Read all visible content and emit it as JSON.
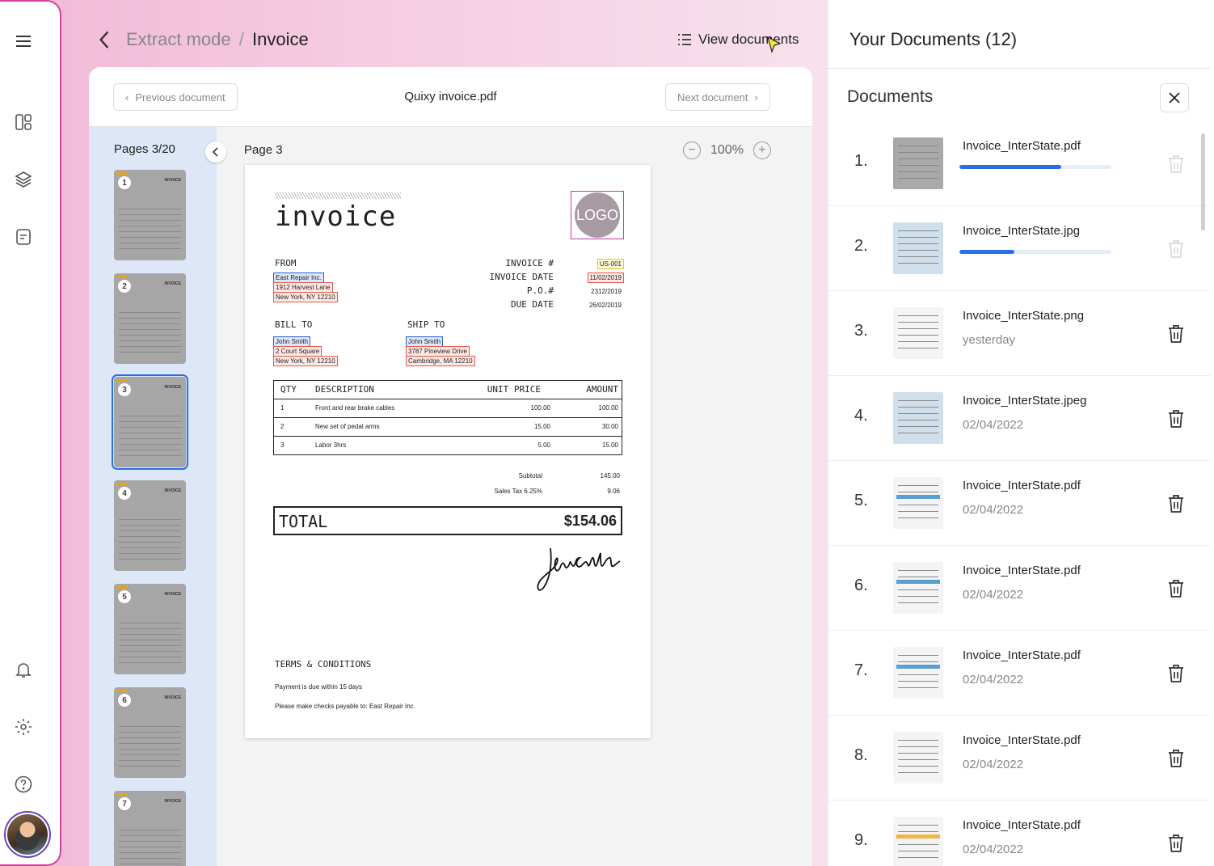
{
  "breadcrumb": {
    "mode": "Extract mode",
    "separator": "/",
    "current": "Invoice"
  },
  "view_documents_label": "View documents",
  "doc_nav": {
    "prev_label": "Previous document",
    "next_label": "Next document",
    "filename": "Quixy invoice.pdf"
  },
  "pages_label": "Pages 3/20",
  "page_label": "Page 3",
  "zoom": {
    "value": "100%",
    "minus": "−",
    "plus": "+"
  },
  "thumbnails": [
    {
      "num": "1",
      "title": "INVOICE"
    },
    {
      "num": "2",
      "title": "INVOICE"
    },
    {
      "num": "3",
      "title": "INVOICE",
      "active": true
    },
    {
      "num": "4",
      "title": "INVOICE"
    },
    {
      "num": "5",
      "title": "INVOICE"
    },
    {
      "num": "6",
      "title": "INVOICE"
    },
    {
      "num": "7",
      "title": "INVOICE"
    }
  ],
  "invoice": {
    "title": "invoice",
    "logo": "LOGO",
    "from_label": "FROM",
    "from_lines": [
      "East Repair Inc.",
      "1912 Harvest Lane",
      "New York, NY 12210"
    ],
    "meta_labels": [
      "INVOICE #",
      "INVOICE DATE",
      "P.O.#",
      "DUE DATE"
    ],
    "meta_values": [
      "US-001",
      "11/02/2019",
      "2312/2019",
      "26/02/2019"
    ],
    "bill_to_label": "BILL TO",
    "bill_to_lines": [
      "John Smith",
      "2 Court Square",
      "New York, NY 12210"
    ],
    "ship_to_label": "SHIP TO",
    "ship_to_lines": [
      "John Smith",
      "3787 Pineview Drive",
      "Cambridge, MA 12210"
    ],
    "table_headers": [
      "QTY",
      "DESCRIPTION",
      "UNIT PRICE",
      "AMOUNT"
    ],
    "table_rows": [
      [
        "1",
        "Front and rear brake cables",
        "100.00",
        "100.00"
      ],
      [
        "2",
        "New set of pedal arms",
        "15.00",
        "30.00"
      ],
      [
        "3",
        "Labor 3hrs",
        "5.00",
        "15.00"
      ]
    ],
    "subtotal_label": "Subtotal",
    "subtotal_value": "145.00",
    "tax_label": "Sales Tax 6.25%",
    "tax_value": "9.06",
    "total_label": "TOTAL",
    "total_value": "$154.06",
    "signature": "John Smith",
    "terms_label": "TERMS & CONDITIONS",
    "terms_lines": [
      "Payment is due within 15 days",
      "Please make checks payable to: East Repair Inc."
    ]
  },
  "documents_panel": {
    "title": "Your Documents (12)",
    "subtitle": "Documents",
    "items": [
      {
        "num": "1.",
        "name": "Invoice_InterState.pdf",
        "meta": "",
        "progress": 0.67,
        "thumb": "gray"
      },
      {
        "num": "2.",
        "name": "Invoice_InterState.jpg",
        "meta": "",
        "progress": 0.36,
        "thumb": "blue"
      },
      {
        "num": "3.",
        "name": "Invoice_InterState.png",
        "meta": "yesterday",
        "thumb": "text"
      },
      {
        "num": "4.",
        "name": "Invoice_InterState.jpeg",
        "meta": "02/04/2022",
        "thumb": "blue"
      },
      {
        "num": "5.",
        "name": "Invoice_InterState.pdf",
        "meta": "02/04/2022",
        "thumb": "light"
      },
      {
        "num": "6.",
        "name": "Invoice_InterState.pdf",
        "meta": "02/04/2022",
        "thumb": "light"
      },
      {
        "num": "7.",
        "name": "Invoice_InterState.pdf",
        "meta": "02/04/2022",
        "thumb": "light"
      },
      {
        "num": "8.",
        "name": "Invoice_InterState.pdf",
        "meta": "02/04/2022",
        "thumb": "text"
      },
      {
        "num": "9.",
        "name": "Invoice_InterState.pdf",
        "meta": "02/04/2022",
        "thumb": "orange"
      }
    ]
  },
  "icons": {
    "menu": "menu-icon",
    "dashboard": "dashboard-icon",
    "layers": "layers-icon",
    "document": "document-icon",
    "bell": "bell-icon",
    "settings": "gear-icon",
    "help": "help-icon"
  },
  "colors": {
    "accent": "#2a6fe0",
    "brand_border": "#d3409a",
    "highlight_blue": "#2b5fd0",
    "highlight_red": "#e05a4d",
    "highlight_yellow": "#e3c43a"
  }
}
